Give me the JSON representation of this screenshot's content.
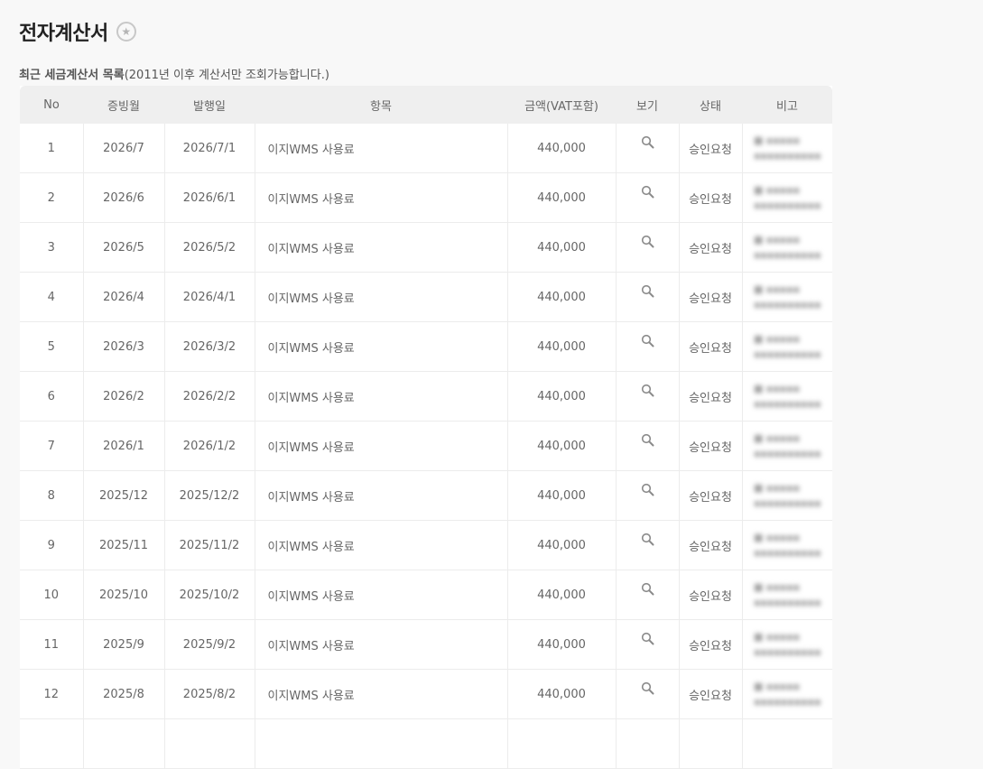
{
  "page": {
    "title": "전자계산서",
    "favorite_icon": "star-icon",
    "caption_strong": "최근 세금계산서 목록",
    "caption_rest": "(2011년 이후 계산서만 조회가능합니다.)"
  },
  "table": {
    "headers": [
      "No",
      "증빙월",
      "발행일",
      "항목",
      "금액(VAT포함)",
      "보기",
      "상태",
      "비고"
    ],
    "view_icon": "magnifier-icon",
    "rows": [
      {
        "no": "1",
        "month": "2026/7",
        "date": "2026/7/1",
        "item": "이지WMS 사용료",
        "amount": "440,000",
        "status": "승인요청"
      },
      {
        "no": "2",
        "month": "2026/6",
        "date": "2026/6/1",
        "item": "이지WMS 사용료",
        "amount": "440,000",
        "status": "승인요청"
      },
      {
        "no": "3",
        "month": "2026/5",
        "date": "2026/5/2",
        "item": "이지WMS 사용료",
        "amount": "440,000",
        "status": "승인요청"
      },
      {
        "no": "4",
        "month": "2026/4",
        "date": "2026/4/1",
        "item": "이지WMS 사용료",
        "amount": "440,000",
        "status": "승인요청"
      },
      {
        "no": "5",
        "month": "2026/3",
        "date": "2026/3/2",
        "item": "이지WMS 사용료",
        "amount": "440,000",
        "status": "승인요청"
      },
      {
        "no": "6",
        "month": "2026/2",
        "date": "2026/2/2",
        "item": "이지WMS 사용료",
        "amount": "440,000",
        "status": "승인요청"
      },
      {
        "no": "7",
        "month": "2026/1",
        "date": "2026/1/2",
        "item": "이지WMS 사용료",
        "amount": "440,000",
        "status": "승인요청"
      },
      {
        "no": "8",
        "month": "2025/12",
        "date": "2025/12/2",
        "item": "이지WMS 사용료",
        "amount": "440,000",
        "status": "승인요청"
      },
      {
        "no": "9",
        "month": "2025/11",
        "date": "2025/11/2",
        "item": "이지WMS 사용료",
        "amount": "440,000",
        "status": "승인요청"
      },
      {
        "no": "10",
        "month": "2025/10",
        "date": "2025/10/2",
        "item": "이지WMS 사용료",
        "amount": "440,000",
        "status": "승인요청"
      },
      {
        "no": "11",
        "month": "2025/9",
        "date": "2025/9/2",
        "item": "이지WMS 사용료",
        "amount": "440,000",
        "status": "승인요청"
      },
      {
        "no": "12",
        "month": "2025/8",
        "date": "2025/8/2",
        "item": "이지WMS 사용료",
        "amount": "440,000",
        "status": "승인요청"
      },
      {
        "no": "",
        "month": "",
        "date": "",
        "item": "",
        "amount": "",
        "status": ""
      }
    ]
  }
}
